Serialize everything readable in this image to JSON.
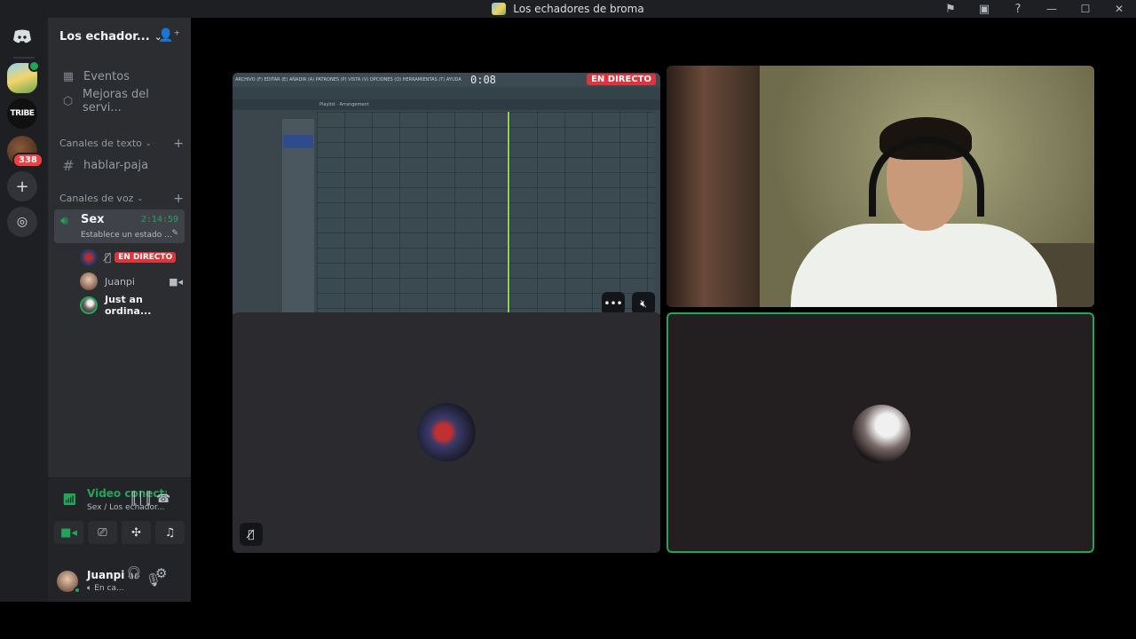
{
  "window": {
    "title": "Los echadores de broma"
  },
  "rail": {
    "server2_label": "TRIBE",
    "server3_badge": "338",
    "icons": [
      "discord-icon",
      "add-server-icon",
      "explore-icon"
    ]
  },
  "sidebar": {
    "server_name": "Los echador...",
    "nav": [
      {
        "label": "Eventos",
        "icon": "calendar-icon"
      },
      {
        "label": "Mejoras del servi...",
        "icon": "boost-icon"
      }
    ],
    "text_category": "Canales de texto",
    "text_channels": [
      {
        "label": "hablar-paja",
        "icon": "hash-icon"
      }
    ],
    "voice_category": "Canales de voz",
    "voice_channel": {
      "name": "Sex",
      "timer": "2:14:59",
      "status": "Establece un estado ..."
    },
    "voice_users": [
      {
        "name": "",
        "live": "EN DIRECTO"
      },
      {
        "name": "Juanpi"
      },
      {
        "name": "Just an ordina..."
      }
    ]
  },
  "voice_panel": {
    "title": "Video conectado",
    "subtitle": "Sex / Los echador..."
  },
  "user_panel": {
    "username": "Juanpi",
    "status": "En ca..."
  },
  "stage": {
    "screen_share": {
      "menu_text": "ARCHIVO (F) EDITAR (E) AÑADIR (A) PATRONES (P) VISTA (V) OPCIONES (O) HERRAMIENTAS (T) AYUDA",
      "timer": "0:08",
      "live_label": "EN DIRECTO",
      "playlist_label": "Playlist · Arrangement"
    }
  },
  "colors": {
    "accent_green": "#23a559",
    "live_red": "#da373c",
    "sidebar_bg": "#2b2d31",
    "rail_bg": "#1e1f22"
  }
}
